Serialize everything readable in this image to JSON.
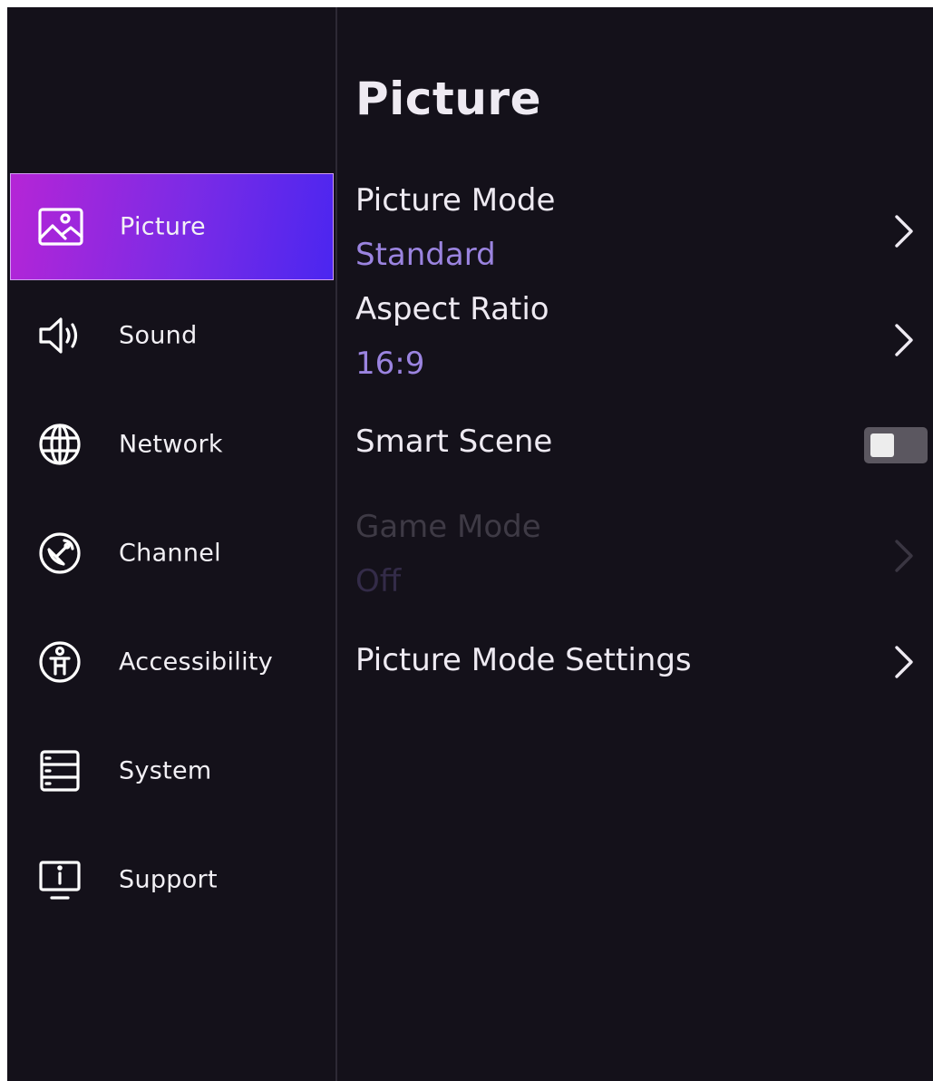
{
  "sidebar": {
    "items": [
      {
        "label": "Picture",
        "icon": "image-icon",
        "selected": true
      },
      {
        "label": "Sound",
        "icon": "speaker-icon",
        "selected": false
      },
      {
        "label": "Network",
        "icon": "globe-icon",
        "selected": false
      },
      {
        "label": "Channel",
        "icon": "antenna-dish-icon",
        "selected": false
      },
      {
        "label": "Accessibility",
        "icon": "accessibility-icon",
        "selected": false
      },
      {
        "label": "System",
        "icon": "server-rack-icon",
        "selected": false
      },
      {
        "label": "Support",
        "icon": "info-monitor-icon",
        "selected": false
      }
    ]
  },
  "main": {
    "title": "Picture",
    "settings": [
      {
        "label": "Picture Mode",
        "value": "Standard",
        "type": "submenu",
        "enabled": true
      },
      {
        "label": "Aspect Ratio",
        "value": "16:9",
        "type": "submenu",
        "enabled": true
      },
      {
        "label": "Smart Scene",
        "type": "toggle",
        "state": "off",
        "enabled": true
      },
      {
        "label": "Game Mode",
        "value": "Off",
        "type": "submenu",
        "enabled": false
      },
      {
        "label": "Picture Mode Settings",
        "type": "submenu",
        "enabled": true
      }
    ]
  },
  "colors": {
    "background": "#14111a",
    "selected_gradient_start": "#b525d6",
    "selected_gradient_end": "#4b26f0",
    "value_text": "#9b84e0",
    "text": "#eeeaf2",
    "disabled_text": "#3e3a45"
  }
}
